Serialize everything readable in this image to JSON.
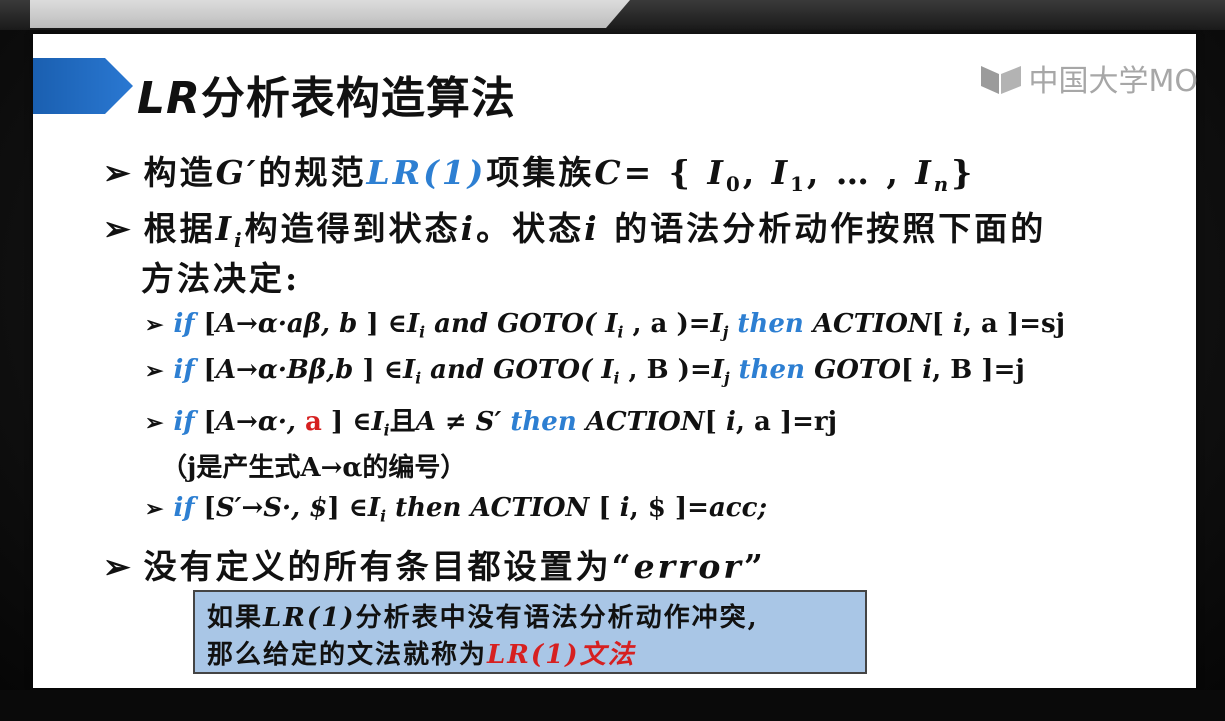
{
  "slide": {
    "title_lr": "LR",
    "title_rest": "分析表构造算法",
    "watermark": "中国大学MO"
  },
  "bullets": {
    "b1": {
      "marker": "➢",
      "p1": "构造",
      "g": "G′",
      "p2": "的规范",
      "lr1": "LR(1)",
      "p3": "项集族",
      "c": "C",
      "p4": "= { ",
      "i0": "I",
      "i0sub": "0",
      "comma1": ", ",
      "i1": "I",
      "i1sub": "1",
      "dots": ", … , ",
      "in": "I",
      "insub": "n",
      "close": "}"
    },
    "b2": {
      "marker": "➢",
      "p1": "根据",
      "ii": "I",
      "iisub": "i",
      "p2": "构造得到状态",
      "i": "i",
      "p3": "。状态",
      "i2": "i",
      "p4": " 的语法分析动作按照下面的",
      "line2": "方法决定:"
    },
    "r1": {
      "marker": "➢",
      "if": "if",
      "p1": " [",
      "lhs": "A→α·aβ, b",
      "p2": " ] ∈",
      "I": "I",
      "isub": "i",
      "and": " and GOTO( ",
      "I2": "I",
      "i2sub": "i",
      "p3": " , a )=",
      "Ij": "I",
      "jsub": "j",
      "then": " then ",
      "action": "ACTION",
      "p4": "[ ",
      "iv": "i",
      "p5": ", a ]=sj"
    },
    "r2": {
      "marker": "➢",
      "if": "if",
      "p1": " [",
      "lhs": "A→α·Bβ,b",
      "p2": " ] ∈",
      "I": "I",
      "isub": "i",
      "and": " and GOTO( ",
      "I2": "I",
      "i2sub": "i",
      "p3": " , B )=",
      "Ij": "I",
      "jsub": "j",
      "then": " then ",
      "goto": "GOTO",
      "p4": "[ ",
      "iv": "i",
      "p5": ", B ]=j"
    },
    "r3": {
      "marker": "➢",
      "if": "if",
      "p1": " [",
      "lhs": "A→α·, ",
      "a": "a",
      "p2": " ] ∈",
      "I": "I",
      "isub": "i",
      "qie": "且",
      "cond": "A ≠ S′",
      "then": " then ",
      "action": "ACTION",
      "p4": "[ ",
      "iv": "i",
      "p5": ", a ]=rj",
      "note": "（j是产生式A→α的编号）"
    },
    "r4": {
      "marker": "➢",
      "if": "if",
      "p1": " [",
      "lhs": "S′→S·, $",
      "p2": "] ∈",
      "I": "I",
      "isub": "i",
      "then": " then ",
      "action": "ACTION",
      "p4": " [ ",
      "iv": "i",
      "p5": ", $ ]=",
      "acc": "acc;"
    },
    "b3": {
      "marker": "➢",
      "text": "没有定义的所有条目都设置为“",
      "error": "error",
      "close": "”"
    }
  },
  "note": {
    "l1_p1": "如果",
    "l1_lr": "LR(1)",
    "l1_p2": "分析表中没有语法分析动作冲突,",
    "l2_p1": "那么给定的文法就称为",
    "l2_lr": "LR(1)文法"
  }
}
